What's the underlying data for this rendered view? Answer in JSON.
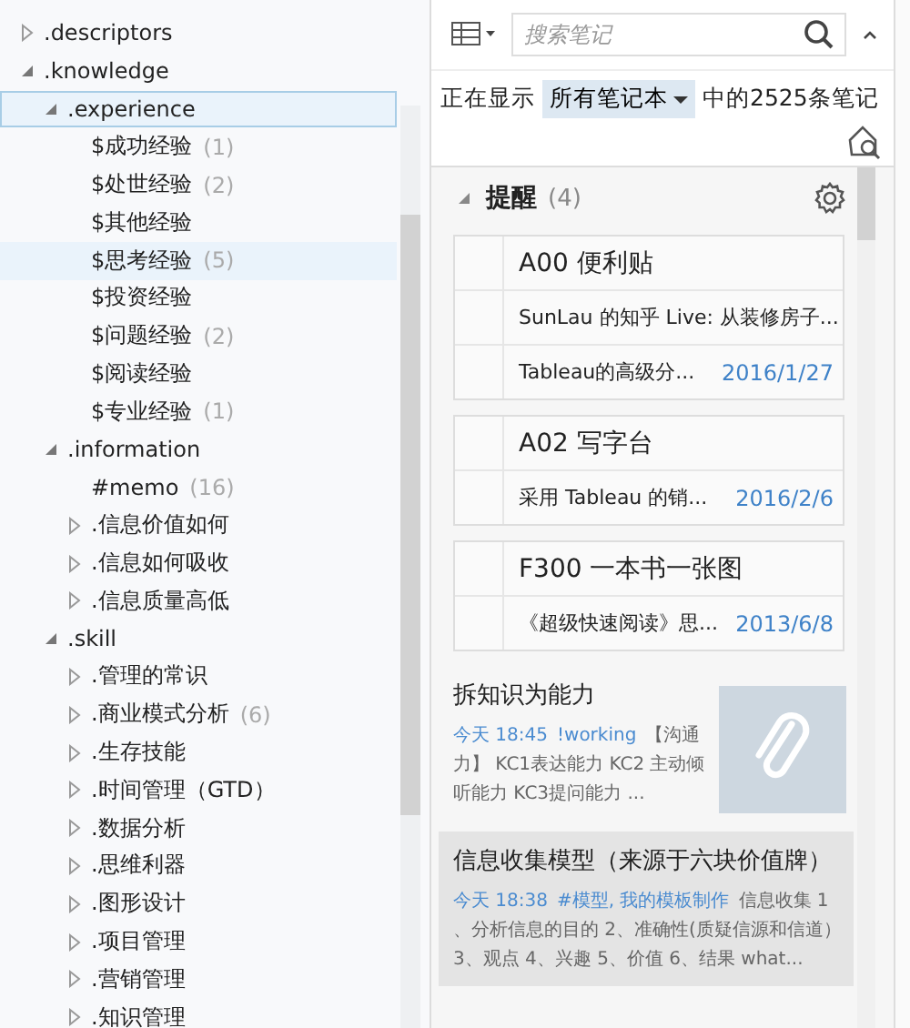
{
  "tree": [
    {
      "label": ".descriptors",
      "expanded": false,
      "selected": false,
      "focused": false
    },
    {
      "label": ".knowledge",
      "expanded": true,
      "selected": false,
      "focused": false,
      "children": [
        {
          "label": ".experience",
          "expanded": true,
          "selected": true,
          "focused": true,
          "children": [
            {
              "label": "$成功经验",
              "count": "(1)",
              "selected": false,
              "focused": false
            },
            {
              "label": "$处世经验",
              "count": "(2)",
              "selected": false,
              "focused": false
            },
            {
              "label": "$其他经验",
              "selected": false,
              "focused": false
            },
            {
              "label": "$思考经验",
              "count": "(5)",
              "selected": true,
              "focused": false
            },
            {
              "label": "$投资经验",
              "selected": false,
              "focused": false
            },
            {
              "label": "$问题经验",
              "count": "(2)",
              "selected": false,
              "focused": false
            },
            {
              "label": "$阅读经验",
              "selected": false,
              "focused": false
            },
            {
              "label": "$专业经验",
              "count": "(1)",
              "selected": false,
              "focused": false
            }
          ]
        },
        {
          "label": ".information",
          "expanded": true,
          "selected": false,
          "focused": false,
          "children": [
            {
              "label": "#memo",
              "count": "(16)",
              "selected": false,
              "focused": false
            },
            {
              "label": ".信息价值如何",
              "expanded": false,
              "selected": false,
              "focused": false
            },
            {
              "label": ".信息如何吸收",
              "expanded": false,
              "selected": false,
              "focused": false
            },
            {
              "label": ".信息质量高低",
              "expanded": false,
              "selected": false,
              "focused": false
            }
          ]
        },
        {
          "label": ".skill",
          "expanded": true,
          "selected": false,
          "focused": false,
          "children": [
            {
              "label": ".管理的常识",
              "expanded": false,
              "selected": false,
              "focused": false
            },
            {
              "label": ".商业模式分析",
              "count": "(6)",
              "expanded": false,
              "selected": false,
              "focused": false
            },
            {
              "label": ".生存技能",
              "expanded": false,
              "selected": false,
              "focused": false
            },
            {
              "label": ".时间管理（GTD）",
              "expanded": false,
              "selected": false,
              "focused": false
            },
            {
              "label": ".数据分析",
              "expanded": false,
              "selected": false,
              "focused": false
            },
            {
              "label": ".思维利器",
              "expanded": false,
              "selected": false,
              "focused": false
            },
            {
              "label": ".图形设计",
              "expanded": false,
              "selected": false,
              "focused": false
            },
            {
              "label": ".项目管理",
              "expanded": false,
              "selected": false,
              "focused": false
            },
            {
              "label": ".营销管理",
              "expanded": false,
              "selected": false,
              "focused": false
            },
            {
              "label": ".知识管理",
              "expanded": false,
              "selected": false,
              "focused": false
            }
          ]
        }
      ]
    }
  ],
  "search": {
    "placeholder": "搜索笔记"
  },
  "filter": {
    "prefix": "正在显示",
    "notebook": "所有笔记本",
    "suffix": "中的2525条笔记"
  },
  "reminders": {
    "title": "提醒",
    "count": "(4)",
    "expanded": true,
    "groups": [
      {
        "title": "A00 便利贴",
        "notes": [
          {
            "text": "SunLau 的知乎 Live: 从装修房子..."
          },
          {
            "text": "Tableau的高级分...",
            "date": "2016/1/27"
          }
        ]
      },
      {
        "title": "A02 写字台",
        "notes": [
          {
            "text": "采用 Tableau 的销...",
            "date": "2016/2/6"
          }
        ]
      },
      {
        "title": "F300 一本书一张图",
        "notes": [
          {
            "text": "《超级快速阅读》思...",
            "date": "2013/6/8"
          }
        ]
      }
    ]
  },
  "notes": [
    {
      "title": "拆知识为能力",
      "time": "今天 18:45",
      "tags": "!working",
      "snippet": "【沟通力】 KC1表达能力 KC2 主动倾听能力 KC3提问能力 ...",
      "attachment": true,
      "selected": false
    },
    {
      "title": "信息收集模型（来源于六块价值牌）",
      "time": "今天 18:38",
      "tags": "#模型, 我的模板制作",
      "snippet": "信息收集 1 、分析信息的目的 2、准确性(质疑信源和信道）3、观点 4、兴趣 5、价值 6、结果 what...",
      "attachment": false,
      "selected": true
    }
  ]
}
